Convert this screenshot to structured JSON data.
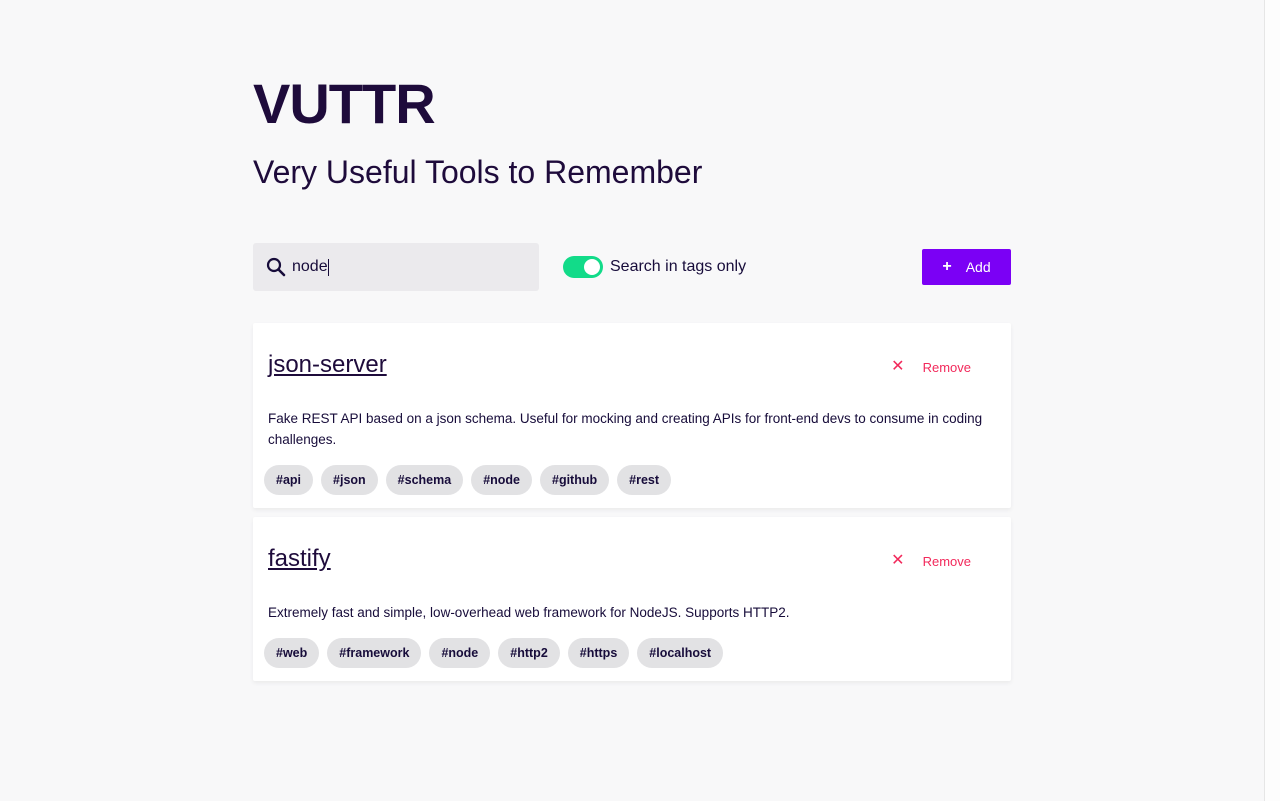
{
  "app": {
    "title": "VUTTR",
    "subtitle": "Very Useful Tools to Remember"
  },
  "toolbar": {
    "search_value": "node",
    "search_placeholder": "",
    "toggle_label": "Search in tags only",
    "toggle_on": true,
    "add_label": "Add"
  },
  "tools": [
    {
      "title": "json-server",
      "remove_label": "Remove",
      "description": "Fake REST API based on a json schema. Useful for mocking and creating APIs for front-end devs to consume in coding challenges.",
      "tags": [
        "#api",
        "#json",
        "#schema",
        "#node",
        "#github",
        "#rest"
      ]
    },
    {
      "title": "fastify",
      "remove_label": "Remove",
      "description": "Extremely fast and simple, low-overhead web framework for NodeJS. Supports HTTP2.",
      "tags": [
        "#web",
        "#framework",
        "#node",
        "#http2",
        "#https",
        "#localhost"
      ]
    }
  ],
  "colors": {
    "accent": "#7b00f5",
    "toggle": "#12db89",
    "danger": "#f2295b",
    "text": "#170c3a",
    "tag_bg": "#e2e2e4"
  },
  "icons": {
    "search": "search-icon",
    "add": "plus-icon",
    "remove": "close-icon"
  }
}
